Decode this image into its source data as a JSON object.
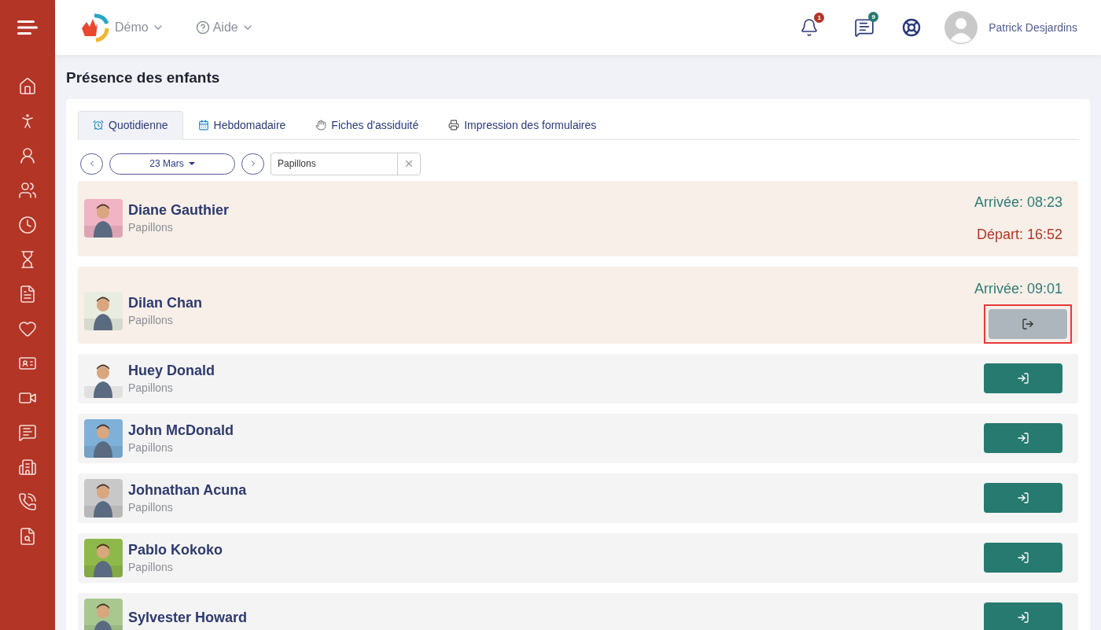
{
  "header": {
    "site": "Démo",
    "help": "Aide",
    "notifications": "1",
    "messages": "9",
    "user": "Patrick Desjardins"
  },
  "page_title": "Présence des enfants",
  "tabs": [
    {
      "label": "Quotidienne",
      "selected": true
    },
    {
      "label": "Hebdomadaire",
      "selected": false
    },
    {
      "label": "Fiches d'assiduité",
      "selected": false
    },
    {
      "label": "Impression des formulaires",
      "selected": false
    }
  ],
  "date": "23 Mars",
  "group_filter": {
    "value": "Papillons"
  },
  "children": [
    {
      "name": "Diane Gauthier",
      "group": "Papillons",
      "kind": "departed",
      "arrival": "Arrivée: 08:23",
      "departure": "Départ: 16:52"
    },
    {
      "name": "Dilan Chan",
      "group": "Papillons",
      "kind": "present",
      "arrival": "Arrivée: 09:01",
      "highlighted": true
    },
    {
      "name": "Huey Donald",
      "group": "Papillons",
      "kind": "absent"
    },
    {
      "name": "John McDonald",
      "group": "Papillons",
      "kind": "absent"
    },
    {
      "name": "Johnathan Acuna",
      "group": "Papillons",
      "kind": "absent"
    },
    {
      "name": "Pablo Kokoko",
      "group": "Papillons",
      "kind": "absent"
    },
    {
      "name": "Sylvester Howard",
      "kind": "absent"
    }
  ]
}
